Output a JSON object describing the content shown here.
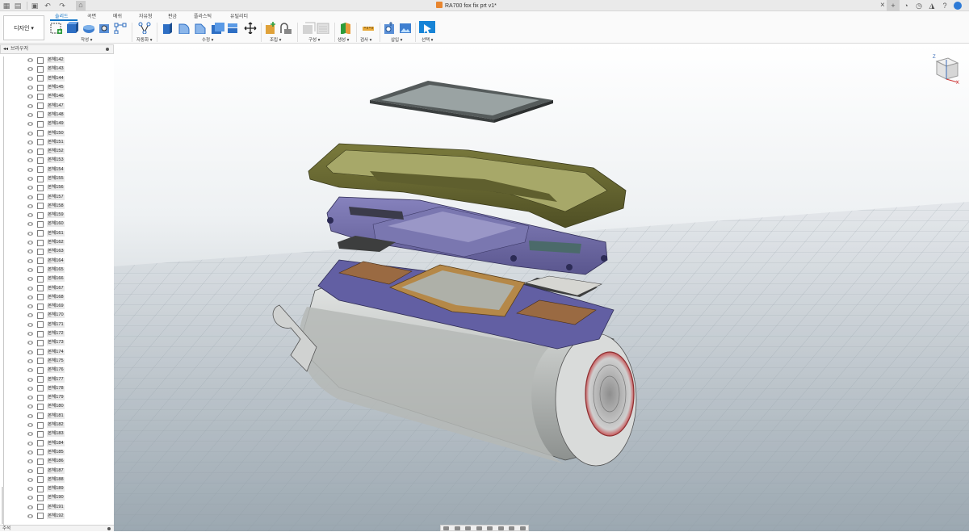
{
  "window": {
    "document_title": "RA700 fox fix prt v1*",
    "close_glyph": "×"
  },
  "ribbon": {
    "workspace_label": "디자인 ▾",
    "tabs": [
      {
        "label": "솔리드",
        "active": true
      },
      {
        "label": "곡면",
        "active": false
      },
      {
        "label": "메쉬",
        "active": false
      },
      {
        "label": "자유형",
        "active": false
      },
      {
        "label": "판금",
        "active": false
      },
      {
        "label": "플라스틱",
        "active": false
      },
      {
        "label": "유틸리티",
        "active": false
      }
    ],
    "groups": [
      {
        "label": "작성 ▾"
      },
      {
        "label": "자동화 ▾"
      },
      {
        "label": "수정 ▾"
      },
      {
        "label": "조립 ▾"
      },
      {
        "label": "구성 ▾"
      },
      {
        "label": "생성 ▾"
      },
      {
        "label": "검사 ▾"
      },
      {
        "label": "삽입 ▾"
      },
      {
        "label": "선택 ▾"
      }
    ],
    "accent_color": "#0f73c6"
  },
  "browser": {
    "title": "브라우저",
    "collapse_glyph": "◂◂",
    "bodies": [
      "본체142",
      "본체143",
      "본체144",
      "본체145",
      "본체146",
      "본체147",
      "본체148",
      "본체149",
      "본체150",
      "본체151",
      "본체152",
      "본체153",
      "본체154",
      "본체155",
      "본체156",
      "본체157",
      "본체158",
      "본체159",
      "본체160",
      "본체161",
      "본체162",
      "본체163",
      "본체164",
      "본체165",
      "본체166",
      "본체167",
      "본체168",
      "본체169",
      "본체170",
      "본체171",
      "본체172",
      "본체173",
      "본체174",
      "본체175",
      "본체176",
      "본체177",
      "본체178",
      "본체179",
      "본체180",
      "본체181",
      "본체182",
      "본체183",
      "본체184",
      "본체185",
      "본체186",
      "본체187",
      "본체188",
      "본체189",
      "본체190",
      "본체191",
      "본체192"
    ]
  },
  "comments": {
    "title": "주석"
  },
  "viewcube": {
    "axis_z": "Z",
    "axis_x": "X"
  },
  "colors": {
    "housing_gray": "#c4c7c5",
    "frame_olive": "#6b6b33",
    "chassis_purple": "#6e6aa6",
    "lens_ring": "#c8585a",
    "board_brown": "#9a6a42"
  }
}
